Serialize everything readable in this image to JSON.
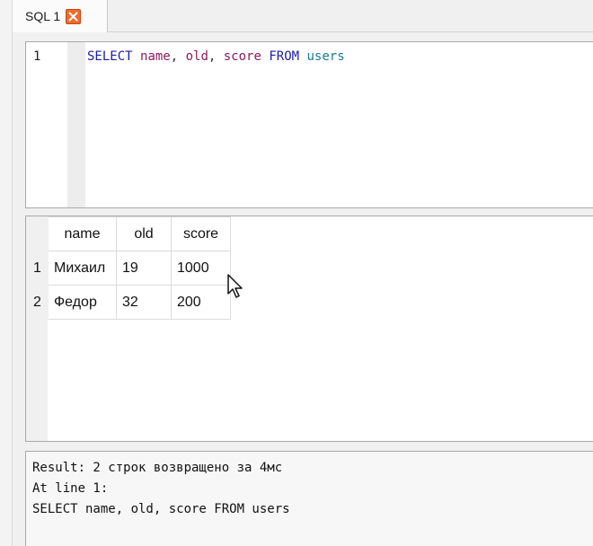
{
  "tab": {
    "label": "SQL 1",
    "close_icon": "close-icon",
    "close_color": "#f06a2a"
  },
  "editor": {
    "line_number": "1",
    "tokens": {
      "select": "SELECT",
      "name": "name",
      "comma1": ", ",
      "old": "old",
      "comma2": ", ",
      "score": "score",
      "from": "FROM",
      "table": "users"
    },
    "colors": {
      "keyword": "#1c1ca8",
      "column": "#8b1a5a",
      "table": "#1a7a8a"
    }
  },
  "results": {
    "columns": [
      "name",
      "old",
      "score"
    ],
    "rows": [
      {
        "num": "1",
        "name": "Михаил",
        "old": "19",
        "score": "1000"
      },
      {
        "num": "2",
        "name": "Федор",
        "old": "32",
        "score": "200"
      }
    ]
  },
  "messages": {
    "line1": "Result: 2 строк возвращено за 4мс",
    "line2": "At line 1:",
    "line3": "SELECT name, old, score FROM users"
  }
}
